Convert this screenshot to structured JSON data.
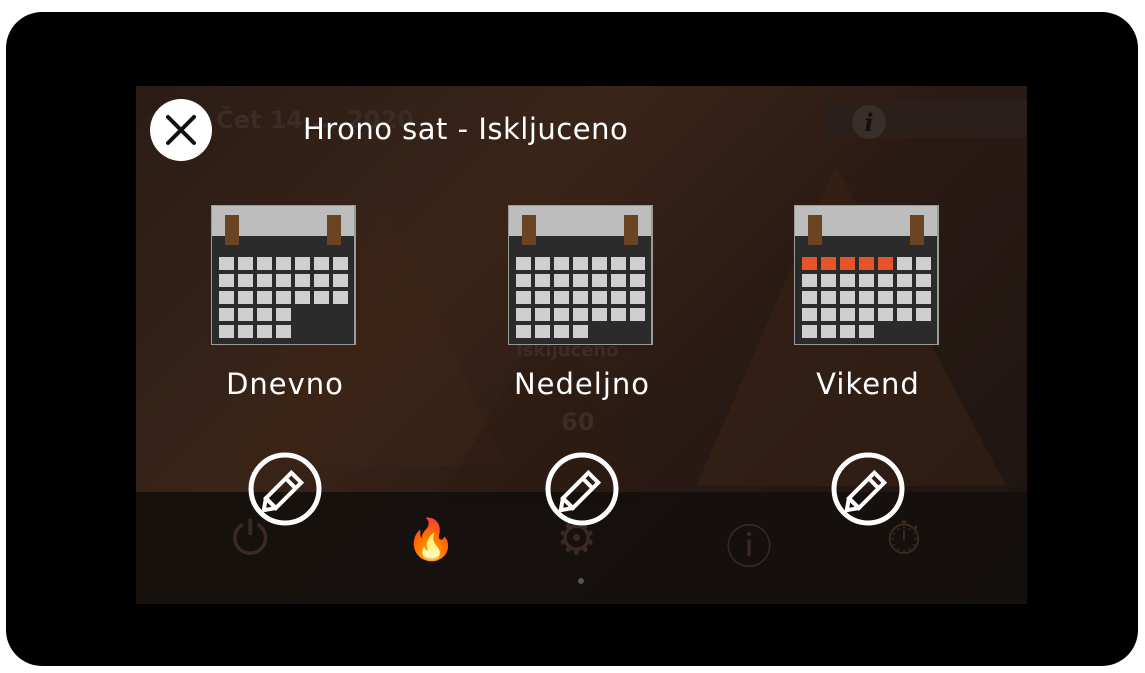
{
  "background": {
    "date_text": "Čet 14 ... 2020",
    "status_text": "Iskljuceno",
    "value_text": "60"
  },
  "header": {
    "title": "Hrono sat - Iskljuceno",
    "close_icon": "close-icon",
    "info_icon": "info-icon"
  },
  "options": [
    {
      "label": "Dnevno",
      "icon": "calendar-daily-icon",
      "edit_icon": "pencil-icon"
    },
    {
      "label": "Nedeljno",
      "icon": "calendar-weekly-icon",
      "edit_icon": "pencil-icon"
    },
    {
      "label": "Vikend",
      "icon": "calendar-weekend-icon",
      "edit_icon": "pencil-icon"
    }
  ],
  "colors": {
    "calendar_header": "#bdbdbd",
    "calendar_body": "#2b2b2b",
    "calendar_cell": "#cfcfcf",
    "calendar_ring": "#6b4423",
    "weekend_highlight": "#e8532a"
  }
}
